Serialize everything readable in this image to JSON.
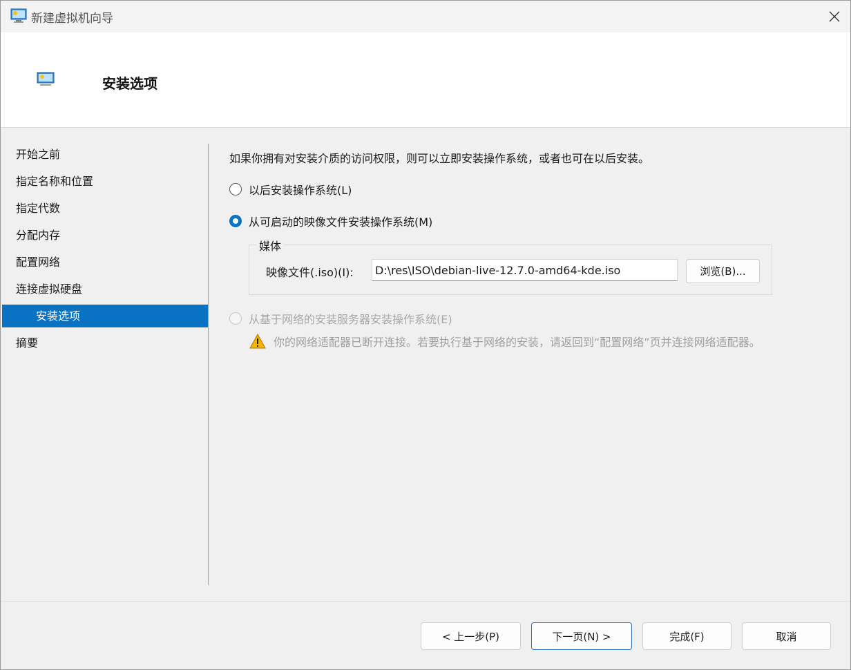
{
  "window": {
    "title": "新建虚拟机向导"
  },
  "header": {
    "title": "安装选项"
  },
  "nav": {
    "items": [
      {
        "label": "开始之前"
      },
      {
        "label": "指定名称和位置"
      },
      {
        "label": "指定代数"
      },
      {
        "label": "分配内存"
      },
      {
        "label": "配置网络"
      },
      {
        "label": "连接虚拟硬盘"
      },
      {
        "label": "安装选项",
        "selected": true
      },
      {
        "label": "摘要"
      }
    ]
  },
  "main": {
    "intro": "如果你拥有对安装介质的访问权限，则可以立即安装操作系统，或者也可在以后安装。",
    "option_later": "以后安装操作系统(L)",
    "option_image": "从可启动的映像文件安装操作系统(M)",
    "media": {
      "legend": "媒体",
      "iso_label": "映像文件(.iso)(I):",
      "iso_value": "D:\\res\\ISO\\debian-live-12.7.0-amd64-kde.iso",
      "browse_label": "浏览(B)..."
    },
    "option_network": "从基于网络的安装服务器安装操作系统(E)",
    "warning": "你的网络适配器已断开连接。若要执行基于网络的安装，请返回到“配置网络”页并连接网络适配器。",
    "selected_option": "image"
  },
  "footer": {
    "prev_label": "< 上一步(P)",
    "next_label": "下一页(N) >",
    "finish_label": "完成(F)",
    "cancel_label": "取消"
  },
  "colors": {
    "accent": "#0a72c2",
    "warning": "#e8a317"
  },
  "icons": [
    "vm-monitor-icon",
    "close-icon",
    "warning-icon"
  ]
}
